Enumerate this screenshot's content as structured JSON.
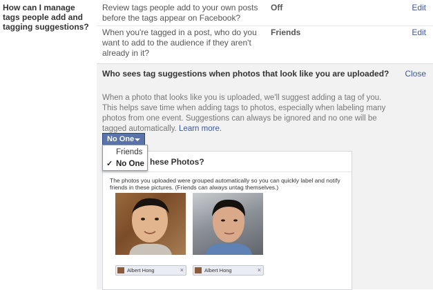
{
  "section": {
    "title": "How can I manage tags people add and tagging suggestions?"
  },
  "rows": [
    {
      "description": "Review tags people add to your own posts before the tags appear on Facebook?",
      "value": "Off",
      "action": "Edit"
    },
    {
      "description": "When you're tagged in a post, who do you want to add to the audience if they aren't already in it?",
      "value": "Friends",
      "action": "Edit"
    }
  ],
  "expanded": {
    "title": "Who sees tag suggestions when photos that look like you are uploaded?",
    "close": "Close",
    "text": "When a photo that looks like you is uploaded, we'll suggest adding a tag of you. This helps save time when adding tags to photos, especially when labeling many photos from one event. Suggestions can always be ignored and no one will be tagged automatically.",
    "link": "Learn more.",
    "selected": "No One",
    "options": [
      "Friends",
      "No One"
    ],
    "check_glyph": "✓"
  },
  "panel": {
    "title": "hese Photos?",
    "text": "The photos you uploaded were grouped automatically so you can quickly label and notify friends in these pictures. (Friends can always untag themselves.)",
    "tags": [
      {
        "name": "Albert Hong",
        "remove": "×"
      },
      {
        "name": "Albert Hong",
        "remove": "×"
      }
    ]
  },
  "colors": {
    "link": "#3b5998",
    "button": "#5b74a8",
    "panel_bg": "#f2f2f2"
  }
}
